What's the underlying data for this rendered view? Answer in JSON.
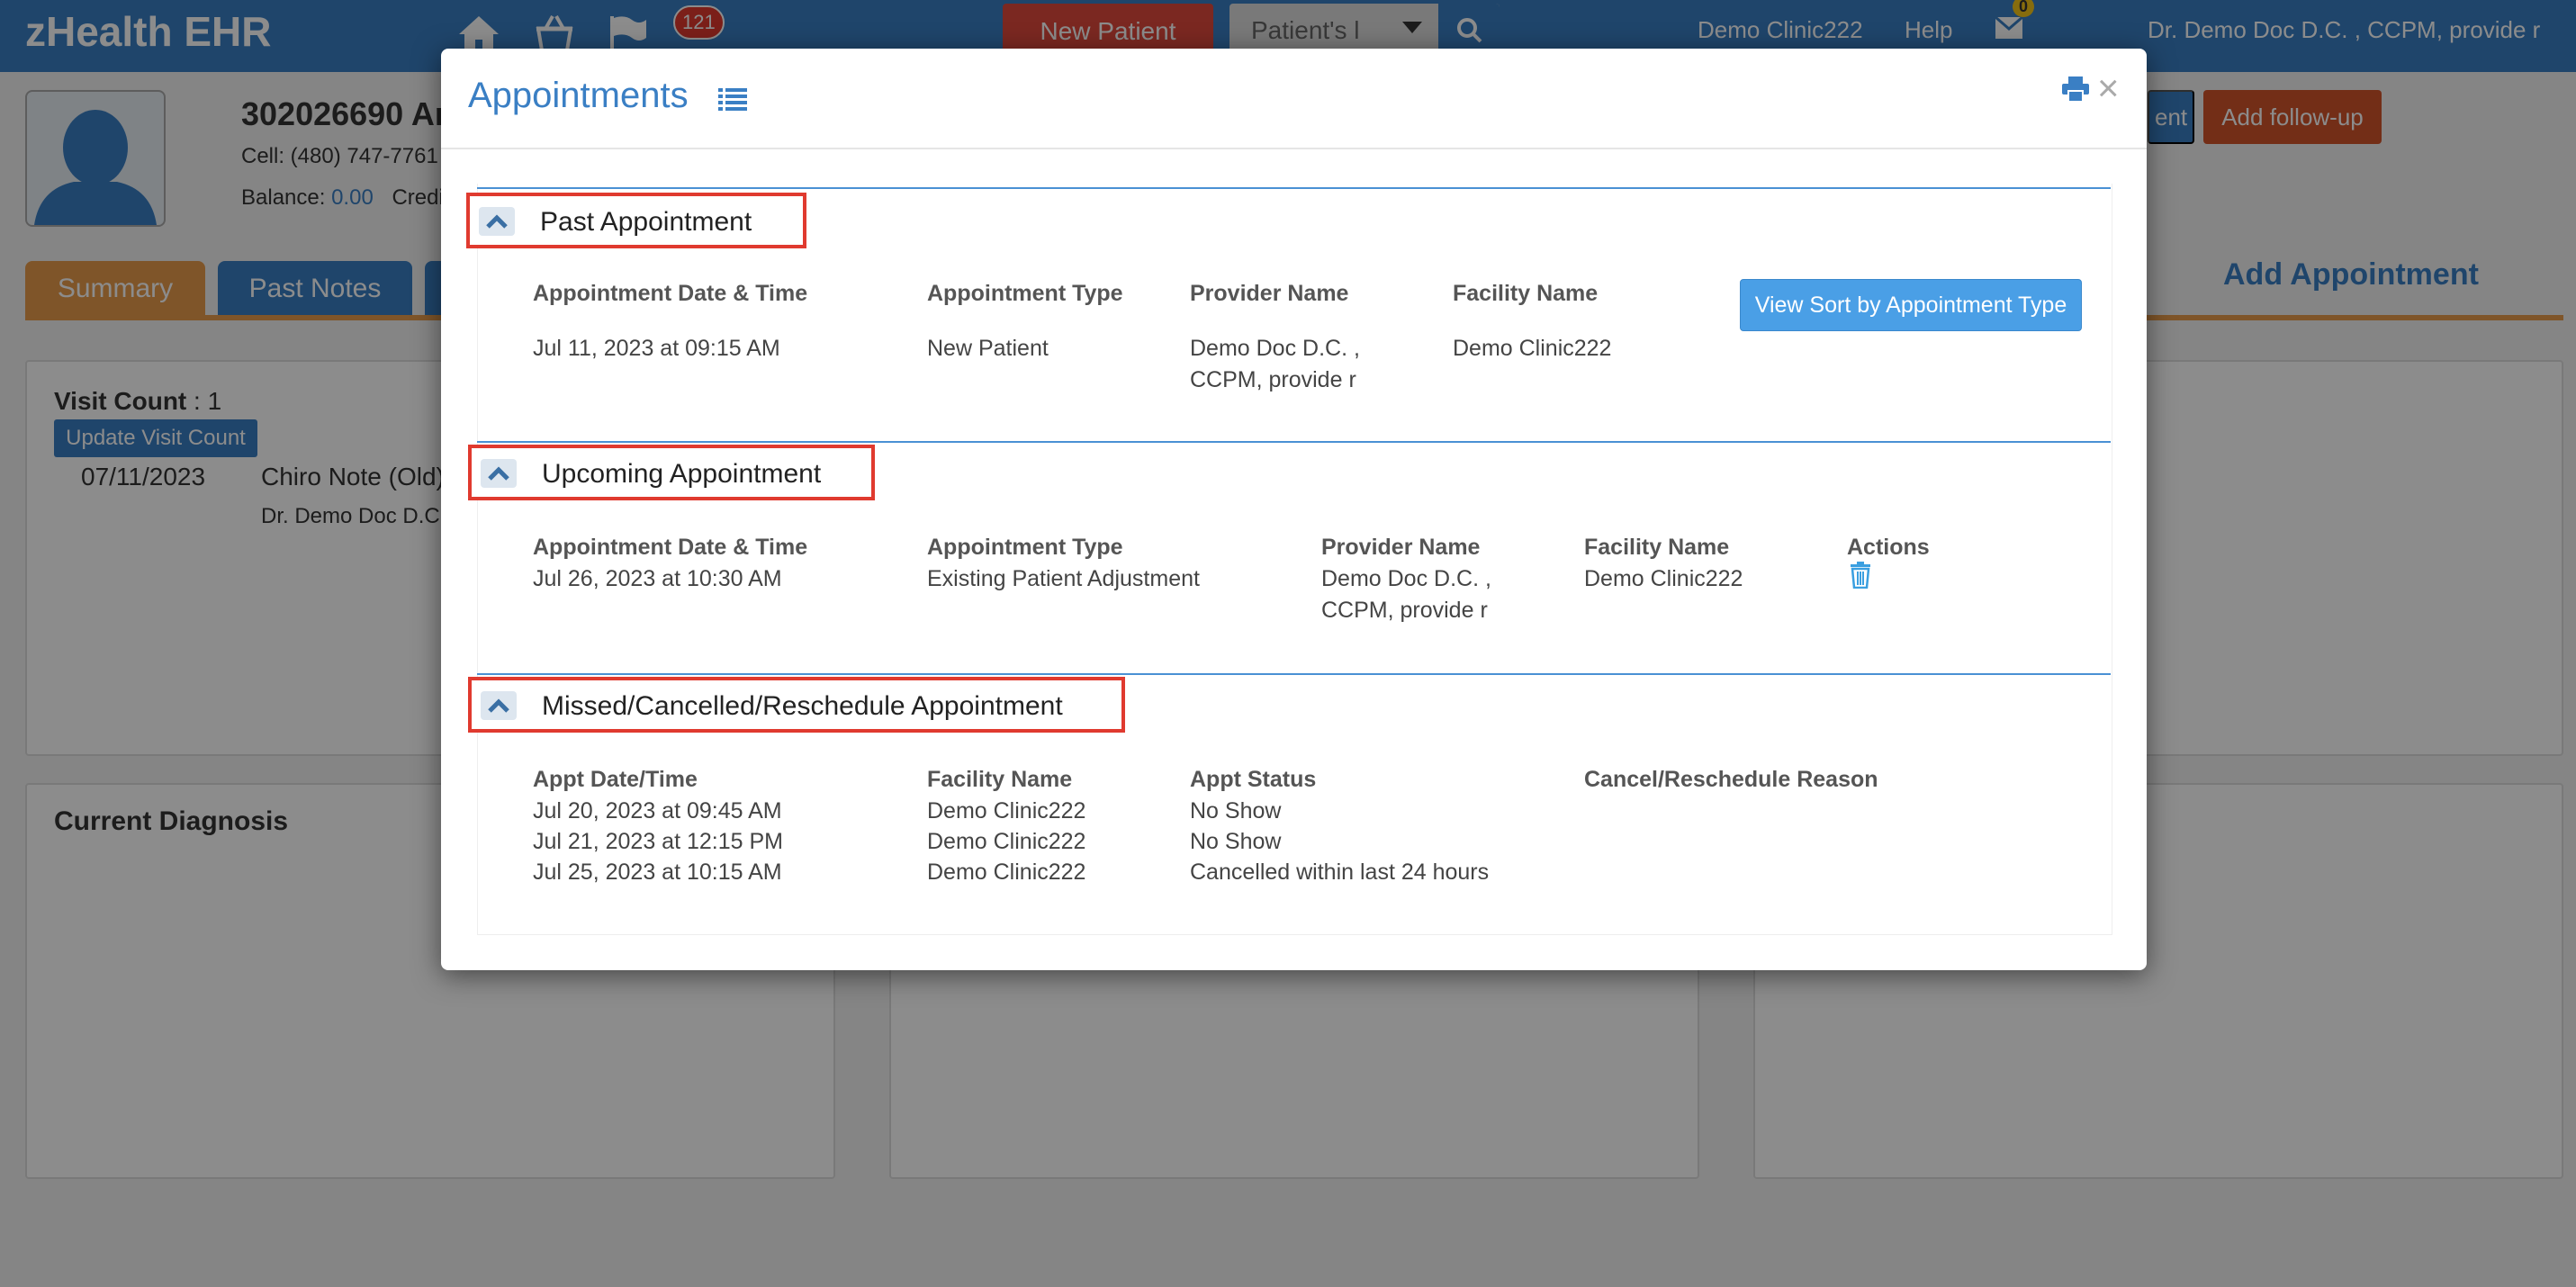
{
  "app": {
    "logo": "zHealth EHR",
    "notification_count": "121",
    "new_patient_label": "New Patient",
    "patient_search_placeholder": "Patient's l",
    "clinic": "Demo Clinic222",
    "help": "Help",
    "mail_count": "0",
    "user": "Dr. Demo Doc D.C. , CCPM, provide r"
  },
  "patient": {
    "id_name": "302026690 Ar",
    "cell": "Cell: (480) 747-7761",
    "balance_label": "Balance:",
    "balance_value": "0.00",
    "credit_label": "Credi"
  },
  "header_buttons": {
    "partial_blue": "ent",
    "follow_up": "Add follow-up"
  },
  "tabs": [
    {
      "label": "Summary"
    },
    {
      "label": "Past Notes"
    }
  ],
  "add_appointment": "Add Appointment",
  "summary": {
    "visit_count_label": "Visit Count",
    "visit_count_value": " : 1",
    "update_visit_count": "Update Visit Count",
    "visit_date": "07/11/2023",
    "visit_note": "Chiro Note (Old)",
    "visit_doctor": "Dr. Demo Doc D.C",
    "current_diagnosis": "Current Diagnosis"
  },
  "modal": {
    "title": "Appointments",
    "past": {
      "heading": "Past Appointment",
      "columns": [
        "Appointment Date & Time",
        "Appointment Type",
        "Provider Name",
        "Facility Name"
      ],
      "sort_button": "View Sort by Appointment Type",
      "rows": [
        {
          "datetime": "Jul 11, 2023 at 09:15 AM",
          "type": "New Patient",
          "provider_line1": "Demo Doc D.C. ,",
          "provider_line2": "CCPM, provide r",
          "facility": "Demo Clinic222"
        }
      ]
    },
    "upcoming": {
      "heading": "Upcoming Appointment",
      "columns": [
        "Appointment Date & Time",
        "Appointment Type",
        "Provider Name",
        "Facility Name",
        "Actions"
      ],
      "rows": [
        {
          "datetime": "Jul 26, 2023 at 10:30 AM",
          "type": "Existing Patient Adjustment",
          "provider_line1": "Demo Doc D.C. ,",
          "provider_line2": "CCPM, provide r",
          "facility": "Demo Clinic222",
          "action_icon": "trash-icon"
        }
      ]
    },
    "missed": {
      "heading": "Missed/Cancelled/Reschedule Appointment",
      "columns": [
        "Appt Date/Time",
        "Facility Name",
        "Appt Status",
        "Cancel/Reschedule Reason"
      ],
      "rows": [
        {
          "datetime": "Jul 20, 2023 at 09:45 AM",
          "facility": "Demo Clinic222",
          "status": "No Show"
        },
        {
          "datetime": "Jul 21, 2023 at 12:15 PM",
          "facility": "Demo Clinic222",
          "status": "No Show"
        },
        {
          "datetime": "Jul 25, 2023 at 10:15 AM",
          "facility": "Demo Clinic222",
          "status": "Cancelled within last 24 hours"
        }
      ]
    }
  },
  "colors": {
    "brand_blue": "#3a7fc4",
    "danger_red": "#e03a2f",
    "followup_orange": "#d2542b",
    "highlight_border": "#e03a2f"
  }
}
